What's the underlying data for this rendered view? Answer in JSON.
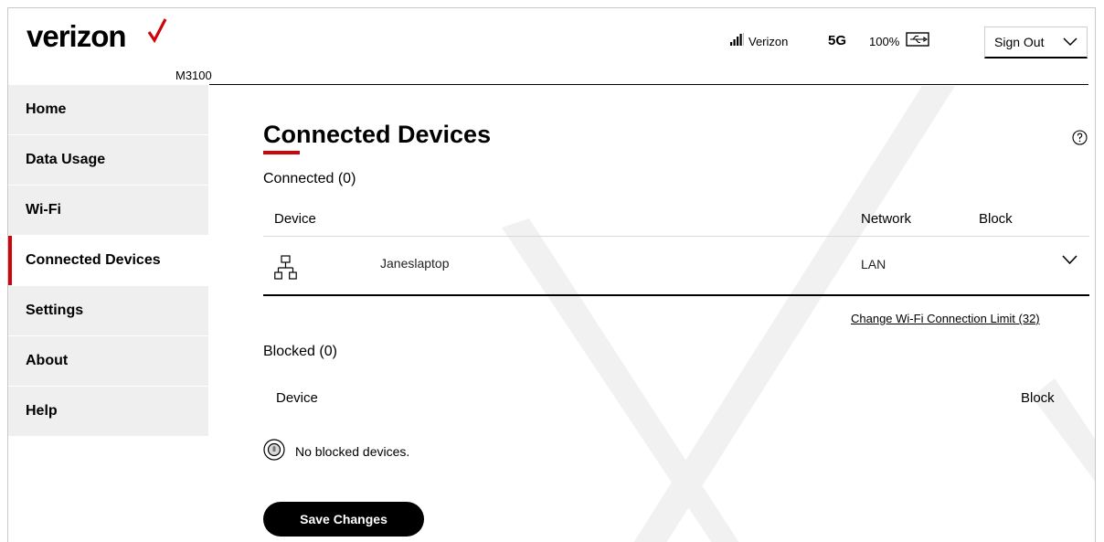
{
  "header": {
    "logo_text": "verizon",
    "model": "M3100",
    "carrier": "Verizon",
    "network_type": "5G",
    "battery": "100%",
    "signout_label": "Sign Out",
    "brand_red": "#cd040b",
    "signal_icon": "signal-bars-icon",
    "usb_icon": "usb-icon"
  },
  "sidebar": {
    "items": [
      {
        "label": "Home"
      },
      {
        "label": "Data Usage"
      },
      {
        "label": "Wi-Fi"
      },
      {
        "label": "Connected Devices",
        "active": true
      },
      {
        "label": "Settings"
      },
      {
        "label": "About"
      },
      {
        "label": "Help"
      }
    ]
  },
  "main": {
    "title": "Connected Devices",
    "connected": {
      "title": "Connected (0)",
      "columns": {
        "device": "Device",
        "network": "Network",
        "block": "Block"
      },
      "rows": [
        {
          "icon": "network-icon",
          "name": "Janeslaptop",
          "network": "LAN"
        }
      ]
    },
    "wifi_limit_link": "Change Wi-Fi Connection Limit (32)",
    "blocked": {
      "title": "Blocked (0)",
      "columns": {
        "device": "Device",
        "block": "Block"
      },
      "empty_text": "No blocked devices."
    },
    "save_label": "Save Changes"
  }
}
